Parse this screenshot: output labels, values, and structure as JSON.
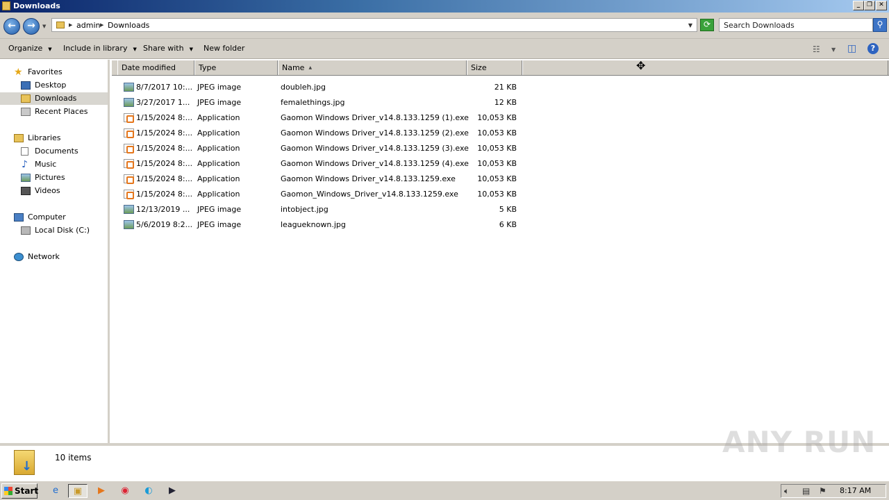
{
  "window": {
    "title": "Downloads",
    "controls": [
      "_",
      "❐",
      "✕"
    ]
  },
  "address": {
    "crumbs": [
      "admin",
      "Downloads"
    ],
    "search_placeholder": "Search Downloads"
  },
  "toolbar": {
    "organize": "Organize",
    "include_in_library": "Include in library",
    "share_with": "Share with",
    "new_folder": "New folder"
  },
  "nav": {
    "favorites": "Favorites",
    "desktop": "Desktop",
    "downloads": "Downloads",
    "recent_places": "Recent Places",
    "libraries": "Libraries",
    "documents": "Documents",
    "music": "Music",
    "pictures": "Pictures",
    "videos": "Videos",
    "computer": "Computer",
    "local_disk": "Local Disk (C:)",
    "network": "Network"
  },
  "columns": {
    "date_modified": "Date modified",
    "type": "Type",
    "name": "Name",
    "size": "Size"
  },
  "files": [
    {
      "date": "8/7/2017 10:...",
      "type": "JPEG image",
      "name": "doubleh.jpg",
      "size": "21 KB",
      "icon": "image-file-icon"
    },
    {
      "date": "3/27/2017 1...",
      "type": "JPEG image",
      "name": "femalethings.jpg",
      "size": "12 KB",
      "icon": "image-file-icon"
    },
    {
      "date": "1/15/2024 8:...",
      "type": "Application",
      "name": "Gaomon Windows Driver_v14.8.133.1259 (1).exe",
      "size": "10,053 KB",
      "icon": "application-file-icon"
    },
    {
      "date": "1/15/2024 8:...",
      "type": "Application",
      "name": "Gaomon Windows Driver_v14.8.133.1259 (2).exe",
      "size": "10,053 KB",
      "icon": "application-file-icon"
    },
    {
      "date": "1/15/2024 8:...",
      "type": "Application",
      "name": "Gaomon Windows Driver_v14.8.133.1259 (3).exe",
      "size": "10,053 KB",
      "icon": "application-file-icon"
    },
    {
      "date": "1/15/2024 8:...",
      "type": "Application",
      "name": "Gaomon Windows Driver_v14.8.133.1259 (4).exe",
      "size": "10,053 KB",
      "icon": "application-file-icon"
    },
    {
      "date": "1/15/2024 8:...",
      "type": "Application",
      "name": "Gaomon Windows Driver_v14.8.133.1259.exe",
      "size": "10,053 KB",
      "icon": "application-file-icon"
    },
    {
      "date": "1/15/2024 8:...",
      "type": "Application",
      "name": "Gaomon_Windows_Driver_v14.8.133.1259.exe",
      "size": "10,053 KB",
      "icon": "application-file-icon"
    },
    {
      "date": "12/13/2019 ...",
      "type": "JPEG image",
      "name": "intobject.jpg",
      "size": "5 KB",
      "icon": "image-file-icon"
    },
    {
      "date": "5/6/2019 8:2...",
      "type": "JPEG image",
      "name": "leagueknown.jpg",
      "size": "6 KB",
      "icon": "image-file-icon"
    }
  ],
  "details": {
    "item_count": "10 items"
  },
  "watermark": "ANY RUN",
  "taskbar": {
    "start": "Start",
    "clock": "8:17 AM"
  }
}
